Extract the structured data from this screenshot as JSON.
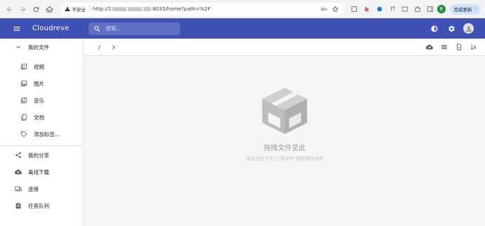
{
  "browser": {
    "security_label": "不安全",
    "url_prefix": "http://1",
    "url_suffix": ":8035/home?path=%2F",
    "update_button": "完成更新",
    "profile_initial": "R"
  },
  "appbar": {
    "title": "Cloudreve",
    "search_placeholder": "搜索..."
  },
  "sidebar": {
    "my_files": "我的文件",
    "sub_items": [
      {
        "label": "视频",
        "icon": "video-icon"
      },
      {
        "label": "图片",
        "icon": "image-icon"
      },
      {
        "label": "音乐",
        "icon": "music-icon"
      },
      {
        "label": "文档",
        "icon": "document-icon"
      },
      {
        "label": "添加标签...",
        "icon": "add-tag-icon"
      }
    ],
    "items": [
      {
        "label": "我的分享",
        "icon": "share-icon"
      },
      {
        "label": "离线下载",
        "icon": "cloud-download-icon"
      },
      {
        "label": "连接",
        "icon": "devices-icon"
      },
      {
        "label": "任务队列",
        "icon": "clipboard-icon"
      }
    ]
  },
  "toolbar": {
    "path_root": "/"
  },
  "empty_state": {
    "title": "拖拽文件至此",
    "subtitle": "或点击右下方\"上传文件\"按钮添加文件"
  }
}
